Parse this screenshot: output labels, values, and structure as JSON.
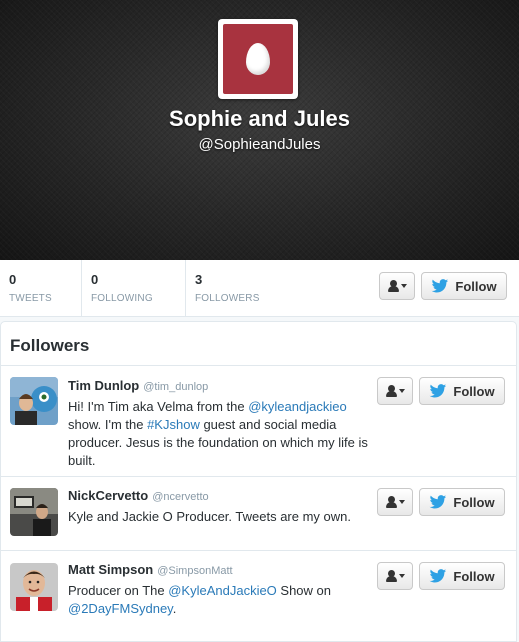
{
  "profile": {
    "name": "Sophie and Jules",
    "handle": "@SophieandJules",
    "avatar_color": "#a8333f"
  },
  "stats": [
    {
      "count": "0",
      "label": "TWEETS"
    },
    {
      "count": "0",
      "label": "FOLLOWING"
    },
    {
      "count": "3",
      "label": "FOLLOWERS"
    }
  ],
  "follow_label": "Follow",
  "followers_section": {
    "title": "Followers",
    "items": [
      {
        "name": "Tim Dunlop",
        "screen_name": "@tim_dunlop",
        "bio": [
          {
            "t": "Hi! I'm Tim aka Velma from the "
          },
          {
            "t": "@kyleandjackieo",
            "link": true
          },
          {
            "t": " show. I'm the "
          },
          {
            "t": "#KJshow",
            "link": true
          },
          {
            "t": " guest and social media producer. Jesus is the foundation on which my life is built."
          }
        ]
      },
      {
        "name": "NickCervetto",
        "screen_name": "@ncervetto",
        "bio": [
          {
            "t": "Kyle and Jackie O Producer. Tweets are my own."
          }
        ]
      },
      {
        "name": "Matt Simpson",
        "screen_name": "@SimpsonMatt",
        "bio": [
          {
            "t": "Producer on The "
          },
          {
            "t": "@KyleAndJackieO",
            "link": true
          },
          {
            "t": " Show on "
          },
          {
            "t": "@2DayFMSydney",
            "link": true
          },
          {
            "t": "."
          }
        ]
      }
    ]
  },
  "colors": {
    "link": "#2a7ab8",
    "twitter_blue": "#2ea1e4"
  },
  "icons": [
    "egg-avatar-icon",
    "user-icon",
    "chevron-down-icon",
    "twitter-bird-icon"
  ]
}
